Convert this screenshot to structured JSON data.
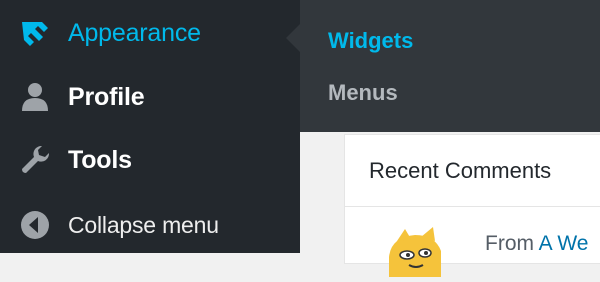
{
  "sidebar": {
    "items": [
      {
        "label": "Appearance",
        "icon": "paintbrush-icon"
      },
      {
        "label": "Profile",
        "icon": "user-icon"
      },
      {
        "label": "Tools",
        "icon": "wrench-icon"
      },
      {
        "label": "Collapse menu",
        "icon": "collapse-arrow-icon"
      }
    ]
  },
  "submenu": {
    "items": [
      {
        "label": "Widgets",
        "active": true
      },
      {
        "label": "Menus",
        "active": false
      }
    ]
  },
  "widget": {
    "title": "Recent Comments",
    "comment_prefix": "From ",
    "comment_author": "A We"
  },
  "colors": {
    "sidebar_bg": "#23282d",
    "submenu_bg": "#32373c",
    "accent": "#00b9eb",
    "link": "#0073aa"
  }
}
